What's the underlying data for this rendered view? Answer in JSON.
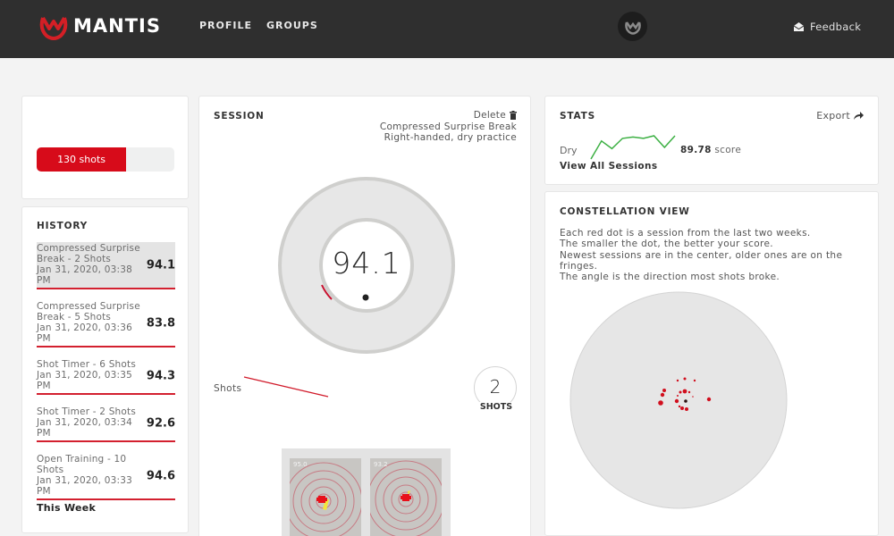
{
  "nav": {
    "brand": "MANTIS",
    "links": [
      "PROFILE",
      "GROUPS"
    ],
    "feedback_label": "Feedback"
  },
  "shots_card": {
    "label": "130 shots",
    "progress_fraction": 0.65
  },
  "history": {
    "title": "HISTORY",
    "items": [
      {
        "name": "Compressed Surprise Break - 2 Shots",
        "date": "Jan 31, 2020, 03:38 PM",
        "score": "94.1",
        "active": true
      },
      {
        "name": "Compressed Surprise Break - 5 Shots",
        "date": "Jan 31, 2020, 03:36 PM",
        "score": "83.8",
        "active": false
      },
      {
        "name": "Shot Timer - 6 Shots",
        "date": "Jan 31, 2020, 03:35 PM",
        "score": "94.3",
        "active": false
      },
      {
        "name": "Shot Timer - 2 Shots",
        "date": "Jan 31, 2020, 03:34 PM",
        "score": "92.6",
        "active": false
      },
      {
        "name": "Open Training - 10 Shots",
        "date": "Jan 31, 2020, 03:33 PM",
        "score": "94.6",
        "active": false
      }
    ],
    "this_week": "This Week"
  },
  "session": {
    "title": "SESSION",
    "delete_label": "Delete",
    "drill": "Compressed Surprise Break",
    "details": "Right-handed, dry practice",
    "score": "94.1",
    "shots_label": "Shots",
    "shot_count": "2",
    "shot_count_caption": "SHOTS",
    "targets": [
      {
        "label": "95.0"
      },
      {
        "label": "93.2"
      }
    ]
  },
  "stats": {
    "title": "STATS",
    "export_label": "Export",
    "mode": "Dry",
    "average": "89.78",
    "average_unit": "score",
    "view_all": "View All Sessions",
    "sparkline": [
      78,
      92,
      86,
      94,
      95,
      94,
      96,
      87,
      96
    ]
  },
  "constellation": {
    "title": "CONSTELLATION VIEW",
    "description": [
      "Each red dot is a session from the last two weeks.",
      "The smaller the dot, the better your score.",
      "Newest sessions are in the center, older ones are on the fringes.",
      "The angle is the direction most shots broke."
    ]
  },
  "colors": {
    "brand_red": "#d70b1a",
    "nav_bg": "#2f2f2f",
    "spark_green": "#3cb043"
  }
}
